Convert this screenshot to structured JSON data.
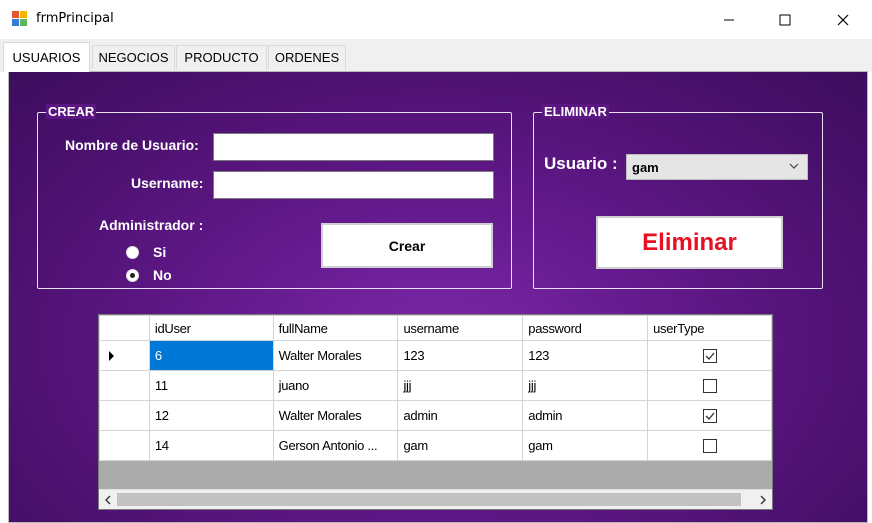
{
  "window": {
    "title": "frmPrincipal"
  },
  "tabs": [
    {
      "label": "USUARIOS",
      "active": true
    },
    {
      "label": "NEGOCIOS",
      "active": false
    },
    {
      "label": "PRODUCTO",
      "active": false
    },
    {
      "label": "ORDENES",
      "active": false
    }
  ],
  "crear": {
    "title": "CREAR",
    "nombre_label": "Nombre de Usuario:",
    "nombre_value": "",
    "username_label": "Username:",
    "username_value": "",
    "admin_label": "Administrador :",
    "radio_si": "Si",
    "radio_no": "No",
    "selected_radio": "No",
    "button_label": "Crear"
  },
  "eliminar": {
    "title": "ELIMINAR",
    "usuario_label": "Usuario :",
    "usuario_selected": "gam",
    "button_label": "Eliminar",
    "button_color": "#e81123"
  },
  "grid": {
    "columns": [
      "idUser",
      "fullName",
      "username",
      "password",
      "userType"
    ],
    "rows": [
      {
        "idUser": "6",
        "fullName": "Walter Morales",
        "username": "123",
        "password": "123",
        "userType": true,
        "current": true
      },
      {
        "idUser": "11",
        "fullName": "juano",
        "username": "jjj",
        "password": "jjj",
        "userType": false
      },
      {
        "idUser": "12",
        "fullName": "Walter Morales",
        "username": "admin",
        "password": "admin",
        "userType": true
      },
      {
        "idUser": "14",
        "fullName": "Gerson Antonio ...",
        "username": "gam",
        "password": "gam",
        "userType": false
      }
    ]
  },
  "colors": {
    "accent_selection": "#0078d7",
    "background_purple": "#5e1785"
  },
  "icons": {
    "app": "app-icon",
    "minimize": "minimize-icon",
    "maximize": "maximize-icon",
    "close": "close-icon",
    "dropdown": "chevron-down-icon",
    "row_indicator": "triangle-right-icon",
    "scroll_left": "chevron-left-icon",
    "scroll_right": "chevron-right-icon"
  }
}
